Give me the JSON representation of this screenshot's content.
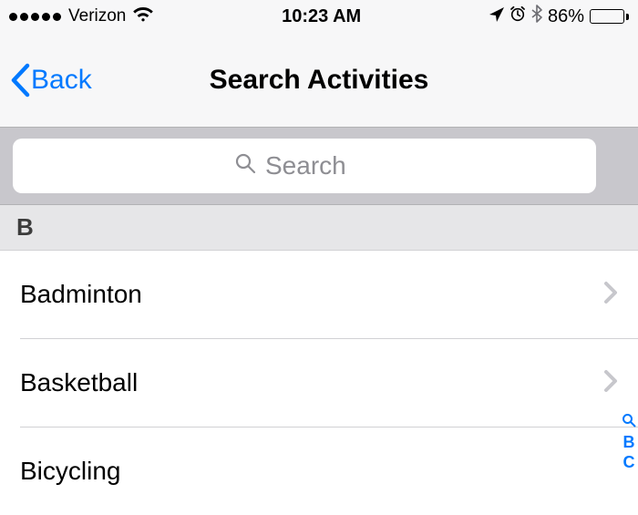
{
  "status": {
    "carrier": "Verizon",
    "time": "10:23 AM",
    "battery_pct": "86%"
  },
  "nav": {
    "back_label": "Back",
    "title": "Search Activities"
  },
  "search": {
    "placeholder": "Search"
  },
  "section": {
    "letter": "B"
  },
  "activities": [
    {
      "label": "Badminton"
    },
    {
      "label": "Basketball"
    },
    {
      "label": "Bicycling"
    }
  ],
  "index": {
    "items": [
      "B",
      "C"
    ]
  },
  "colors": {
    "tint": "#0079ff",
    "separator": "#d1d1d4",
    "bg": "#efeff4"
  }
}
